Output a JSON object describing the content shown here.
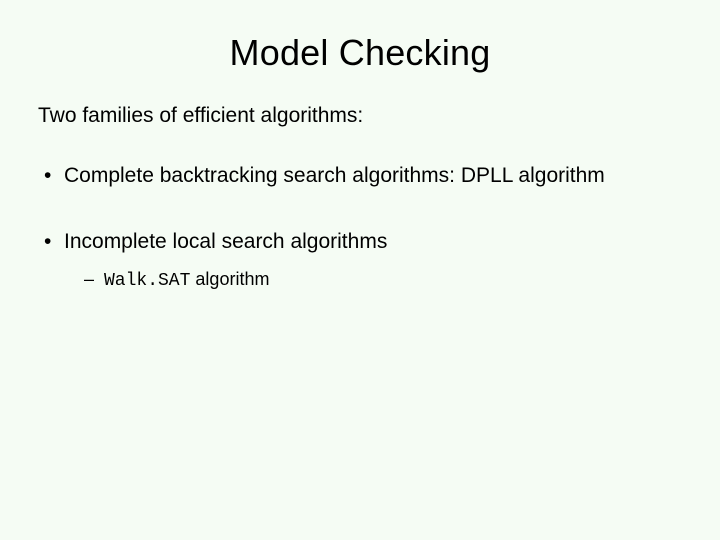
{
  "title": "Model Checking",
  "lead": "Two families of efficient algorithms:",
  "bullets": [
    {
      "text": "Complete backtracking search algorithms:  DPLL  algorithm"
    },
    {
      "text": "Incomplete local search algorithms",
      "sub": [
        {
          "code": "Walk.SAT",
          "rest": " algorithm"
        }
      ]
    }
  ]
}
